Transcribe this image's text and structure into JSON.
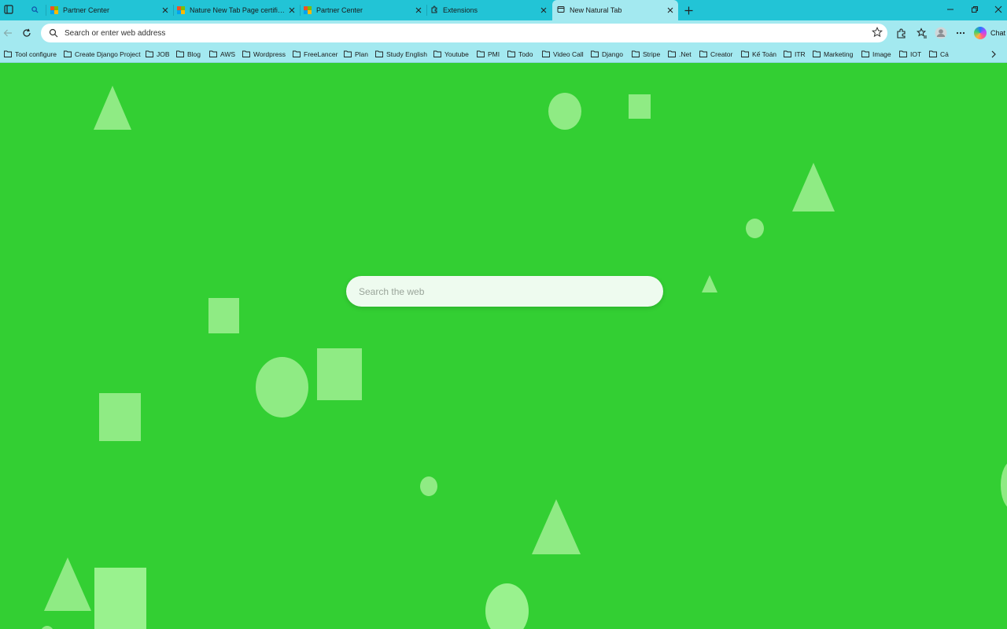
{
  "browser": {
    "tabs": [
      {
        "title": "",
        "favicon": "search-icon"
      },
      {
        "title": "Partner Center",
        "favicon": "microsoft-icon"
      },
      {
        "title": "Nature New Tab Page certification",
        "favicon": "microsoft-icon"
      },
      {
        "title": "Partner Center",
        "favicon": "microsoft-icon"
      },
      {
        "title": "Extensions",
        "favicon": "extensions-icon"
      },
      {
        "title": "New Natural Tab",
        "favicon": "newtab-icon",
        "active": true
      }
    ],
    "address_placeholder": "Search or enter web address",
    "chat_label": "Chat",
    "bookmarks": [
      "Tool configure",
      "Create Django Project",
      "JOB",
      "Blog",
      "AWS",
      "Wordpress",
      "FreeLancer",
      "Plan",
      "Study English",
      "Youtube",
      "PMI",
      "Todo",
      "Video Call",
      "Django",
      "Stripe",
      ".Net",
      "Creator",
      "Kế Toán",
      "ITR",
      "Marketing",
      "Image",
      "IOT",
      "Cá"
    ]
  },
  "page": {
    "search_placeholder": "Search the web",
    "colors": {
      "background": "#33cf33",
      "shape": "#97ee8b",
      "search_box": "#eefbef"
    }
  }
}
